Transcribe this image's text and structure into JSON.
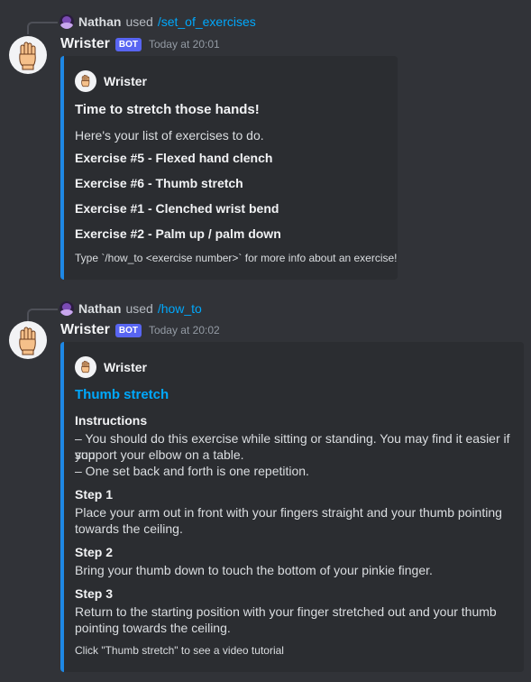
{
  "accent_color": "#1e88e5",
  "messages": [
    {
      "reply": {
        "user": "Nathan",
        "used": "used",
        "command": "/set_of_exercises"
      },
      "author": "Wrister",
      "badge": "BOT",
      "timestamp": "Today at 20:01",
      "embed": {
        "author": "Wrister",
        "title": "Time to stretch those hands!",
        "description": "Here's your list of exercises to do.",
        "exercises": [
          "Exercise #5 - Flexed hand clench",
          "Exercise #6 - Thumb stretch",
          "Exercise #1 - Clenched wrist bend",
          "Exercise #2 - Palm up / palm down"
        ],
        "footer": "Type `/how_to <exercise number>` for more info about an exercise!"
      }
    },
    {
      "reply": {
        "user": "Nathan",
        "used": "used",
        "command": "/how_to"
      },
      "author": "Wrister",
      "badge": "BOT",
      "timestamp": "Today at 20:02",
      "embed": {
        "author": "Wrister",
        "title": "Thumb stretch",
        "fields": [
          {
            "name": "Instructions",
            "lines": [
              "– You should do this exercise while sitting or standing. You may find it easier if you",
              "support your elbow on a table.",
              "– One set back and forth is one repetition."
            ]
          },
          {
            "name": "Step 1",
            "lines": [
              "Place your arm out in front with your fingers straight and your thumb pointing",
              "towards the ceiling."
            ]
          },
          {
            "name": "Step 2",
            "lines": [
              "Bring your thumb down to touch the bottom of your pinkie finger."
            ]
          },
          {
            "name": "Step 3",
            "lines": [
              "Return to the starting position with your finger stretched out and your thumb",
              "pointing towards the ceiling."
            ]
          }
        ],
        "footer": "Click \"Thumb stretch\" to see a video tutorial"
      }
    }
  ]
}
